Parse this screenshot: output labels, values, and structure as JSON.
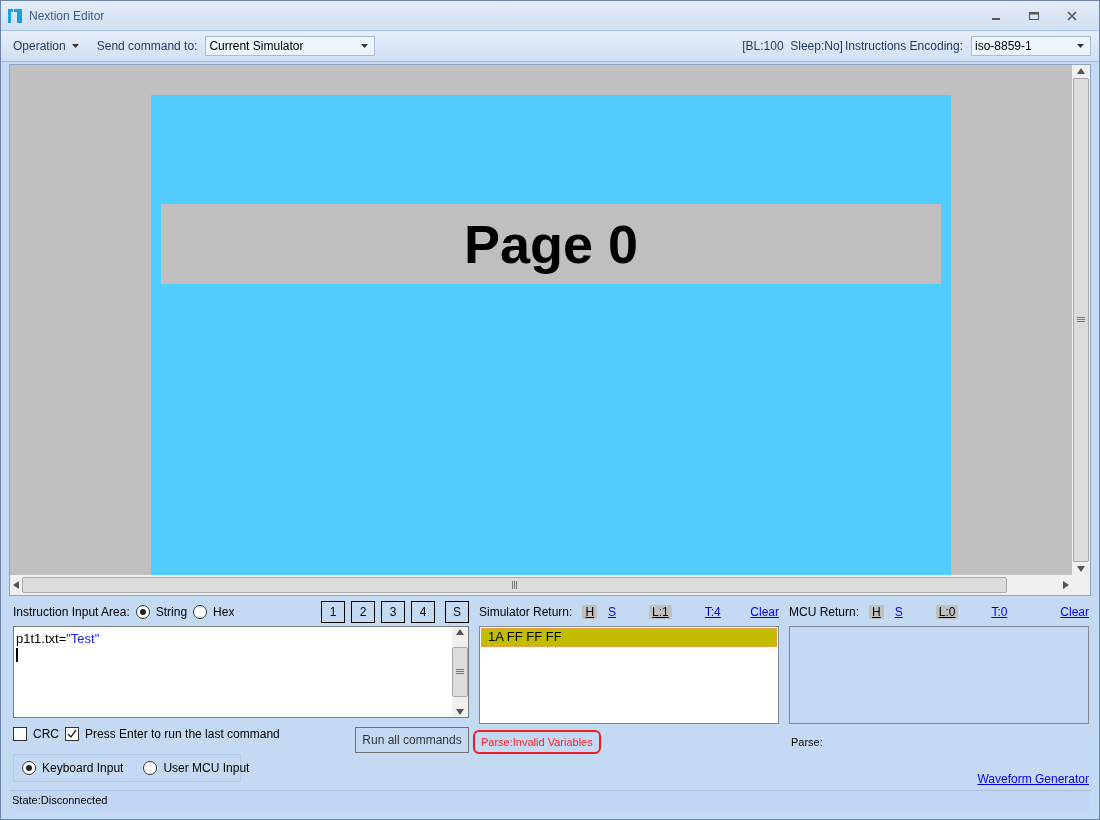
{
  "window": {
    "title": "Nextion Editor"
  },
  "toolbar": {
    "operation_menu": "Operation",
    "send_label": "Send command to:",
    "send_target": "Current Simulator",
    "status_text": "[BL:100  Sleep:No]",
    "encoding_label": "Instructions Encoding:",
    "encoding": "iso-8859-1"
  },
  "display": {
    "page_label": "Page 0"
  },
  "input_area": {
    "label": "Instruction Input Area:",
    "modes": [
      {
        "label": "String",
        "selected": true
      },
      {
        "label": "Hex",
        "selected": false
      }
    ],
    "slot_buttons": [
      "1",
      "2",
      "3",
      "4",
      "S"
    ],
    "command_tokens": [
      {
        "text": "p1t1.txt=",
        "kind": "code"
      },
      {
        "text": "\"Test\"",
        "kind": "string"
      }
    ],
    "options": [
      {
        "label": "CRC",
        "checked": false
      },
      {
        "label": "Press Enter to run the last command",
        "checked": true
      }
    ],
    "run_button": "Run all commands",
    "input_sources": [
      {
        "label": "Keyboard Input",
        "selected": true
      },
      {
        "label": "User MCU Input",
        "selected": false
      }
    ]
  },
  "simulator_return": {
    "label": "Simulator Return:",
    "toggles": [
      {
        "label": "H",
        "selected": true
      },
      {
        "label": "S",
        "selected": false
      },
      {
        "label": "L:1",
        "selected": true
      },
      {
        "label": "T:4",
        "selected": false
      }
    ],
    "clear": "Clear",
    "lines": [
      {
        "text": "1A FF FF FF",
        "selected": true
      }
    ],
    "parse": "Parse:Invalid Variables",
    "highlighted": true
  },
  "mcu_return": {
    "label": "MCU Return:",
    "toggles": [
      {
        "label": "H",
        "selected": true
      },
      {
        "label": "S",
        "selected": false
      },
      {
        "label": "L:0",
        "selected": true
      },
      {
        "label": "T:0",
        "selected": false
      }
    ],
    "clear": "Clear",
    "parse": "Parse:",
    "highlighted": false
  },
  "waveform_link": "Waveform Generator",
  "status_bar": "State:Disconnected"
}
